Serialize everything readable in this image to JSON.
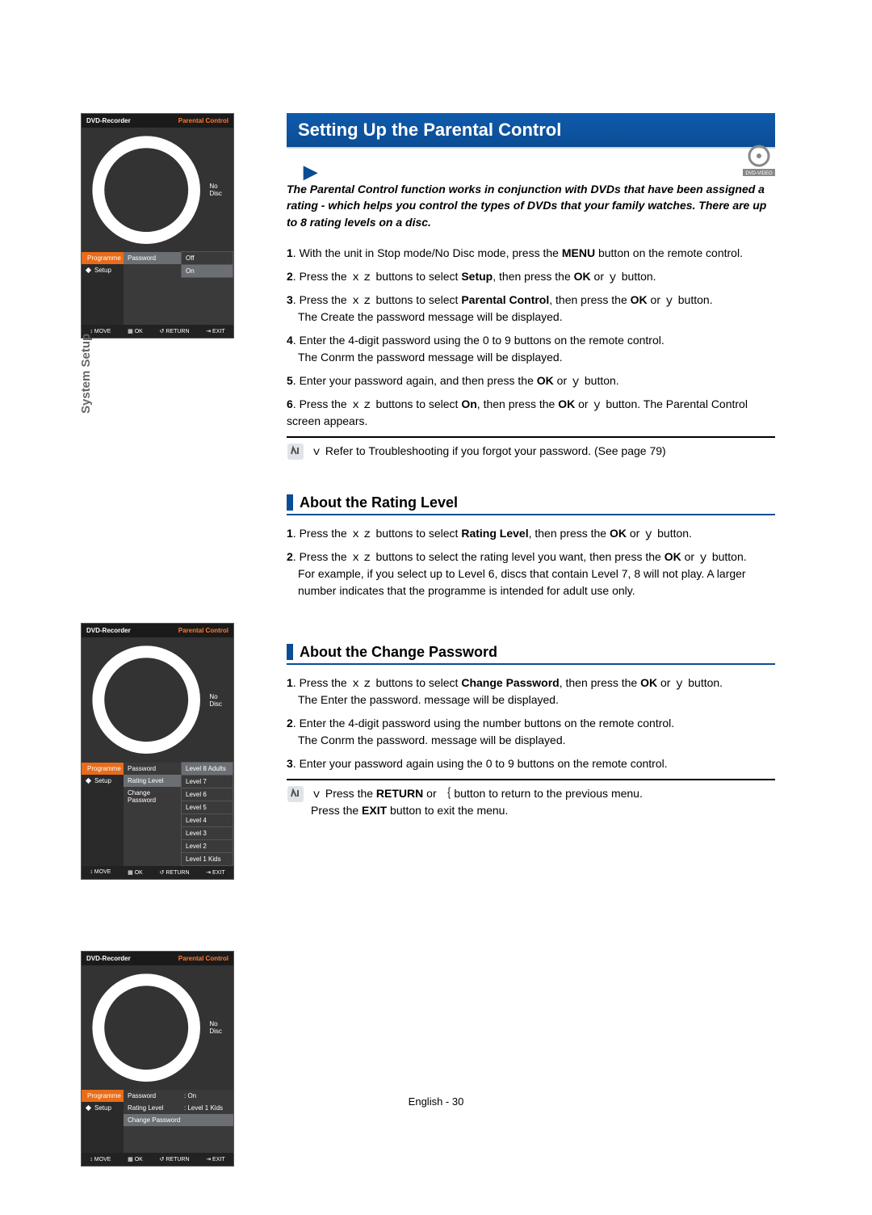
{
  "sidebar_label": "System Setup",
  "section_title": "Setting Up the Parental Control",
  "intro": "The Parental Control function works in conjunction with DVDs that have been assigned a rating - which helps you control the types of DVDs that your family watches. There are up to 8 rating levels on a disc.",
  "steps": [
    {
      "n": "1",
      "pre": "With the unit in Stop mode/No Disc mode, press the ",
      "b1": "MENU",
      "post": " button on the remote control."
    },
    {
      "n": "2",
      "pre": "Press the ｘｚ buttons to select ",
      "b1": "Setup",
      "mid": ", then press the ",
      "b2": "OK",
      "post": " or ｙ button."
    },
    {
      "n": "3",
      "pre": "Press the ｘｚ buttons to select ",
      "b1": "Parental Control",
      "mid": ", then press the ",
      "b2": "OK",
      "post": " or ｙ button.",
      "sub": "The Create the password message will be displayed."
    },
    {
      "n": "4",
      "pre": "Enter the 4-digit password using the 0 to 9 buttons on the remote control.",
      "sub": "The Conrm the password message will be displayed."
    },
    {
      "n": "5",
      "pre": "Enter your password again, and then press the ",
      "b1": "OK",
      "post": " or ｙ button."
    },
    {
      "n": "6",
      "pre": "Press the ｘｚ buttons to select ",
      "b1": "On",
      "mid": ", then press the ",
      "b2": "OK",
      "post": " or ｙ button. The Parental Control screen appears."
    }
  ],
  "note1": "ｖ Refer to Troubleshooting if you forgot your password. (See page 79)",
  "sub1_title": "About the Rating Level",
  "sub1_steps": [
    {
      "n": "1",
      "pre": "Press the ｘｚ buttons to select ",
      "b1": "Rating Level",
      "mid": ", then press the ",
      "b2": "OK",
      "post": " or ｙ button."
    },
    {
      "n": "2",
      "pre": "Press the ｘｚ buttons to select the rating level you want, then press the ",
      "b1": "OK",
      "post": " or ｙ button.",
      "sub": "For example, if you select up to Level 6, discs that contain Level 7, 8 will not play. A larger number indicates that the programme is intended for adult use only."
    }
  ],
  "sub2_title": "About the Change Password",
  "sub2_steps": [
    {
      "n": "1",
      "pre": "Press the ｘｚ buttons to select ",
      "b1": "Change Password",
      "mid": ", then press the ",
      "b2": "OK",
      "post": " or ｙ button.",
      "sub": "The Enter the password. message will be displayed."
    },
    {
      "n": "2",
      "pre": "Enter the 4-digit password using the number buttons on the remote control.",
      "sub": "The Conrm the password. message will be displayed."
    },
    {
      "n": "3",
      "pre": "Enter your password again using the 0 to 9 buttons on the remote control."
    }
  ],
  "note2_l1": "ｖ Press the ",
  "note2_b1": "RETURN",
  "note2_l2": " or ｛ button to return to the previous menu.",
  "note2_l3": "Press the ",
  "note2_b2": "EXIT",
  "note2_l4": " button to exit the menu.",
  "footer": "English - 30",
  "osd": {
    "title": "DVD-Recorder",
    "subtitle": "Parental Control",
    "status": "No Disc",
    "nav": [
      "Programme",
      "Setup"
    ],
    "s1": {
      "list": [
        "Password"
      ],
      "values": [
        "Off",
        "On"
      ]
    },
    "s2": {
      "list": [
        "Password",
        "Rating Level",
        "Change Password"
      ],
      "levels": [
        "Level 8 Adults",
        "Level 7",
        "Level 6",
        "Level 5",
        "Level 4",
        "Level 3",
        "Level 2",
        "Level 1 Kids"
      ]
    },
    "s3": {
      "rows": [
        [
          "Password",
          ": On"
        ],
        [
          "Rating Level",
          ": Level 1 Kids"
        ],
        [
          "Change Password",
          ""
        ]
      ]
    },
    "foot": [
      "↕ MOVE",
      "▦ OK",
      "↺ RETURN",
      "⇥ EXIT"
    ]
  }
}
